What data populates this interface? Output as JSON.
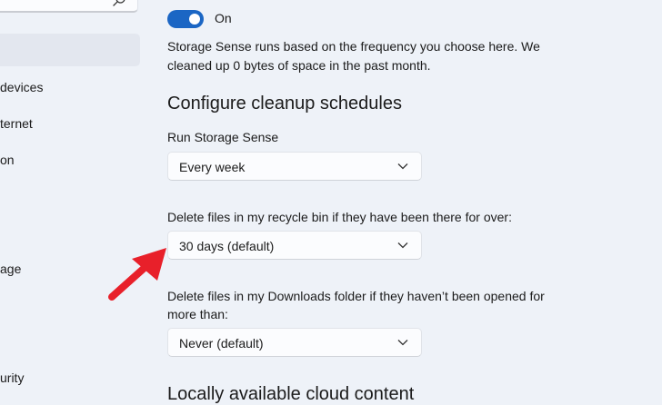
{
  "sidebar": {
    "items": [
      {
        "label": "devices"
      },
      {
        "label": "ternet"
      },
      {
        "label": "on"
      },
      {
        "label": "age"
      },
      {
        "label": "urity"
      }
    ]
  },
  "storage_sense": {
    "toggle_label": "On",
    "toggle_on": true,
    "description": "Storage Sense runs based on the frequency you choose here. We cleaned up 0 bytes of space in the past month."
  },
  "cleanup": {
    "heading": "Configure cleanup schedules",
    "run": {
      "label": "Run Storage Sense",
      "value": "Every week"
    },
    "recycle": {
      "label": "Delete files in my recycle bin if they have been there for over:",
      "value": "30 days (default)"
    },
    "downloads": {
      "label": "Delete files in my Downloads folder if they haven’t been opened for more than:",
      "value": "Never (default)"
    }
  },
  "cloud": {
    "heading": "Locally available cloud content"
  },
  "colors": {
    "accent": "#1b66c4",
    "annotation_arrow": "#e8202a"
  },
  "icons": {
    "search": "search-icon",
    "chevron": "chevron-down-icon",
    "annotation": "red-arrow"
  }
}
